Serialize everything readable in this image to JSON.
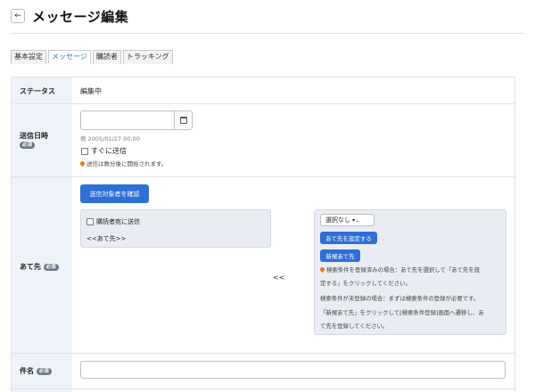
{
  "header": {
    "back_icon": "arrow-left-icon",
    "back_glyph": "←",
    "title": "メッセージ編集"
  },
  "tabs": [
    {
      "label": "基本設定",
      "active": false
    },
    {
      "label": "メッセージ",
      "active": true
    },
    {
      "label": "購読者",
      "active": false
    },
    {
      "label": "トラッキング",
      "active": false
    }
  ],
  "status": {
    "label": "ステータス",
    "value": "編集中"
  },
  "send_date": {
    "label": "送信日時",
    "required": "必須",
    "value": "",
    "placeholder": "",
    "example": "例 2005/01/27 00:00",
    "send_now_label": "すぐに送信",
    "send_now_checked": false,
    "note": "送信は数分後に開始されます。"
  },
  "recipient": {
    "label": "あて先",
    "required": "必須",
    "confirm_button": "送信対象者を確認",
    "subscribe_only_label": "購読者宛に送信",
    "placeholder_text": "<<あて先>>",
    "move_arrows": "<<",
    "select_value": "選択なし",
    "set_button": "あて先を設定する",
    "new_button": "新規あて先",
    "help": [
      "検索条件を登録済みの場合：あて先を選択して「あて先を設",
      "定する」をクリックしてください。",
      "検索条件が未登録の場合：まずは検索条件の登録が必要です。",
      "「新規あて先」をクリックして[検索条件登録]画面へ遷移し、あ",
      "て先を登録してください。"
    ]
  },
  "subject": {
    "label": "件名",
    "required": "必須",
    "value": ""
  },
  "colors": {
    "primary": "#2f6fd6",
    "label_bg": "#eef3fa",
    "badge": "#6b7789",
    "tab_active": "#1a73c9"
  }
}
